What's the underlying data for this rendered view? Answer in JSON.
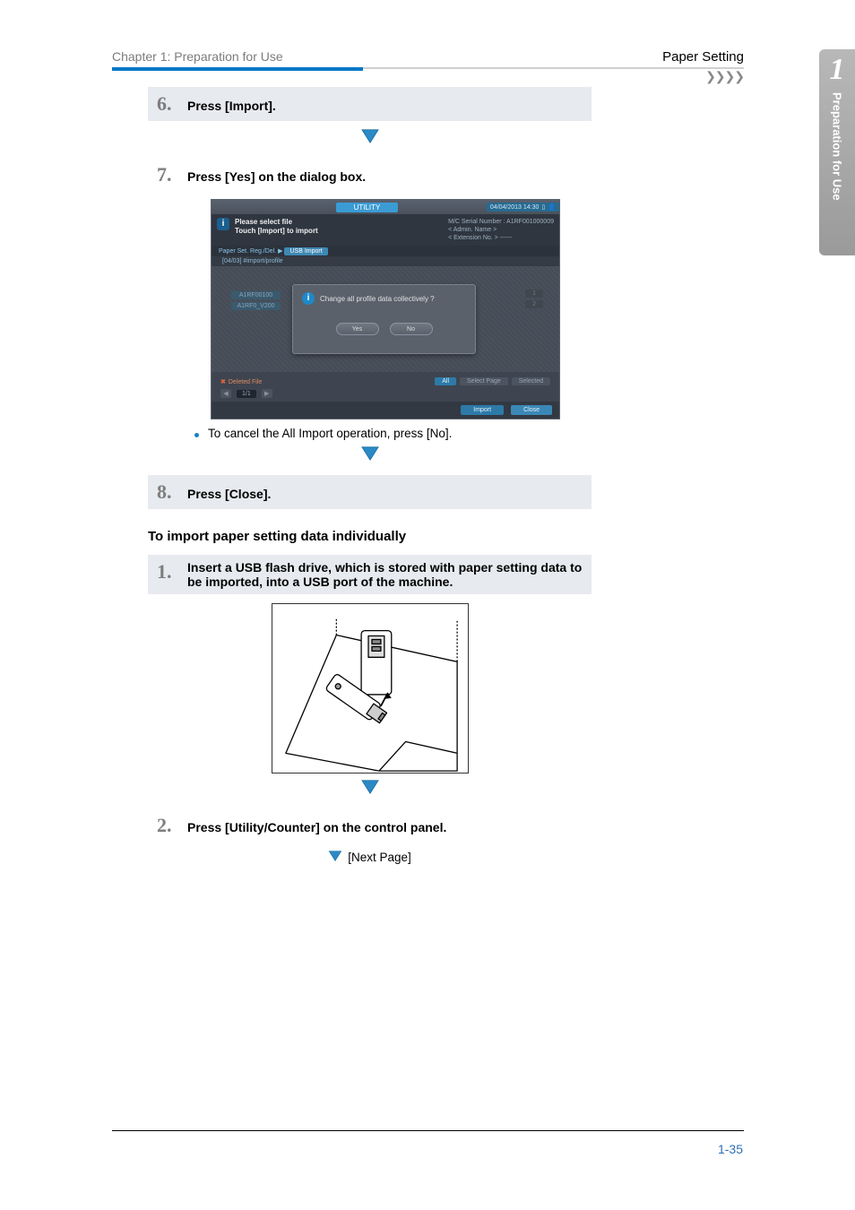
{
  "header": {
    "left": "Chapter 1: Preparation for Use",
    "right": "Paper Setting",
    "arrows": "❯❯❯❯"
  },
  "side_tab": {
    "number": "1",
    "label": "Preparation for Use"
  },
  "steps": [
    {
      "num": "6.",
      "text": "Press [Import]."
    },
    {
      "num": "7.",
      "text": "Press [Yes] on the dialog box."
    },
    {
      "num": "8.",
      "text": "Press [Close]."
    }
  ],
  "screenshot": {
    "utility_label": "UTILITY",
    "datetime": "04/04/2013 14:30",
    "info_line1": "Please select file",
    "info_line2": "Touch [Import] to import",
    "side_serial": "M/C Serial Number : A1RF001000009",
    "side_admin": "< Admin. Name >",
    "side_ext": "< Extension No. >  ------",
    "breadcrumb_left": "Paper Set. Reg./Del.  ▶",
    "breadcrumb_active": "USB Import",
    "subhead": "[04/03] #import/profile",
    "left_label1": "A1RF00100",
    "left_label2": "A1RF0_V200",
    "dialog_msg": "Change all profile data collectively ?",
    "left_side_dim1": "1",
    "left_side_dim2": "2",
    "btn_yes": "Yes",
    "btn_no": "No",
    "deleted": "Deleted File",
    "all": "All",
    "select_page": "Select Page",
    "selected": "Selected",
    "pagecount": "1/1",
    "import_btn": "Import",
    "close_btn": "Close"
  },
  "bullet": "To cancel the All Import operation, press [No].",
  "subheading": "To import paper setting data individually",
  "steps2": [
    {
      "num": "1.",
      "text": "Insert a USB flash drive, which is stored with paper setting data to be imported, into a USB port of the machine."
    },
    {
      "num": "2.",
      "text": "Press [Utility/Counter] on the control panel."
    }
  ],
  "next_page": "[Next Page]",
  "page_number": "1-35"
}
